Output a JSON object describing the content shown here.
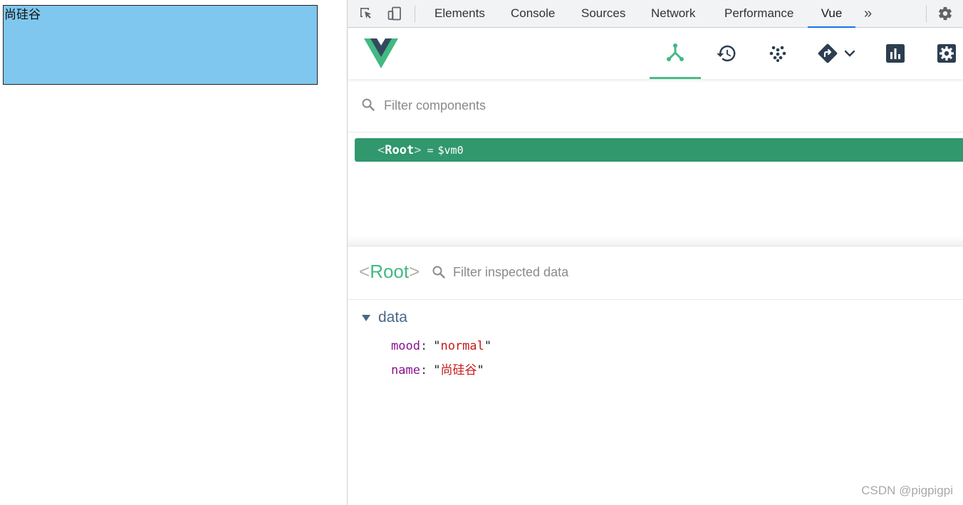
{
  "page": {
    "box_text": "尚硅谷"
  },
  "devtools": {
    "tabs": [
      "Elements",
      "Console",
      "Sources",
      "Network",
      "Performance",
      "Vue"
    ],
    "active_tab": "Vue",
    "more_tabs_glyph": "»"
  },
  "vue": {
    "toolbar": [
      "components-icon",
      "history-icon",
      "vuex-icon",
      "router-icon",
      "performance-icon",
      "settings-icon"
    ],
    "active_tool": "components",
    "component_filter_placeholder": "Filter components",
    "tree": {
      "root_name": "Root",
      "root_ref": "$vm0"
    },
    "inspector": {
      "title": "Root",
      "filter_placeholder": "Filter inspected data",
      "section_label": "data",
      "props": [
        {
          "key": "mood",
          "value": "normal"
        },
        {
          "key": "name",
          "value": "尚硅谷"
        }
      ]
    }
  },
  "watermark": "CSDN @pigpigpi",
  "colors": {
    "vue_green": "#42b983",
    "selected_row": "#31976d",
    "box_fill": "#7fc7ee",
    "devtools_active_tab": "#1a73e8"
  }
}
